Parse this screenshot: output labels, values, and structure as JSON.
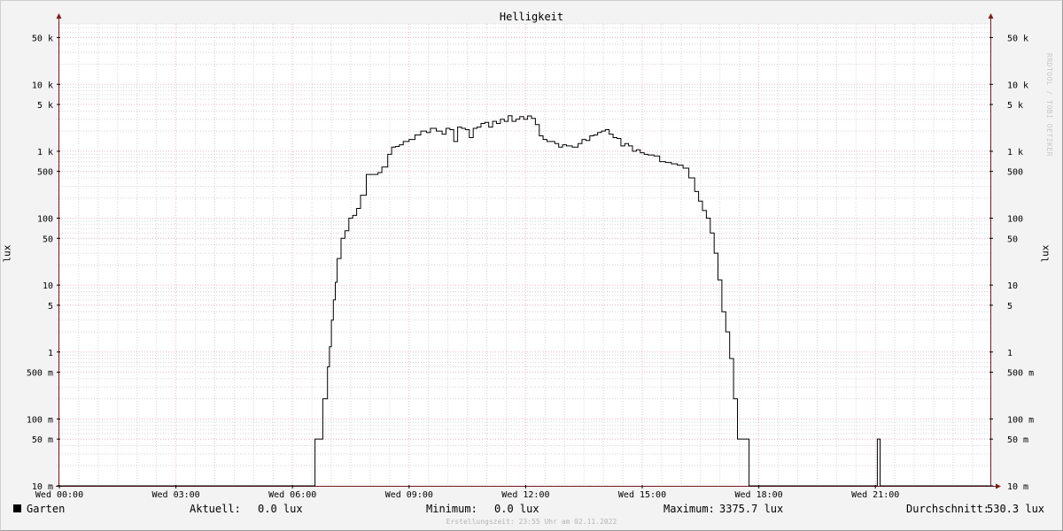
{
  "chart_data": {
    "type": "line",
    "title": "Helligkeit",
    "ylabel": "lux",
    "yscale": "log",
    "ylim": [
      0.01,
      80000
    ],
    "xlim": [
      "00:00",
      "23:55"
    ],
    "x_ticks": [
      {
        "h": 0,
        "label": "Wed 00:00"
      },
      {
        "h": 3,
        "label": "Wed 03:00"
      },
      {
        "h": 6,
        "label": "Wed 06:00"
      },
      {
        "h": 9,
        "label": "Wed 09:00"
      },
      {
        "h": 12,
        "label": "Wed 12:00"
      },
      {
        "h": 15,
        "label": "Wed 15:00"
      },
      {
        "h": 18,
        "label": "Wed 18:00"
      },
      {
        "h": 21,
        "label": "Wed 21:00"
      }
    ],
    "y_ticks": [
      {
        "v": 50000,
        "label": "50 k"
      },
      {
        "v": 10000,
        "label": "10 k"
      },
      {
        "v": 5000,
        "label": "5 k"
      },
      {
        "v": 1000,
        "label": "1 k"
      },
      {
        "v": 500,
        "label": "500"
      },
      {
        "v": 100,
        "label": "100"
      },
      {
        "v": 50,
        "label": "50"
      },
      {
        "v": 10,
        "label": "10"
      },
      {
        "v": 5,
        "label": "5"
      },
      {
        "v": 1,
        "label": "1"
      },
      {
        "v": 0.5,
        "label": "500 m"
      },
      {
        "v": 0.1,
        "label": "100 m"
      },
      {
        "v": 0.05,
        "label": "50 m"
      },
      {
        "v": 0.01,
        "label": "10 m"
      }
    ],
    "grid": true,
    "series": [
      {
        "name": "Garten",
        "color": "#000000",
        "x_hours": [
          0,
          6.58,
          6.62,
          6.78,
          6.9,
          6.95,
          7.0,
          7.05,
          7.1,
          7.15,
          7.25,
          7.35,
          7.45,
          7.55,
          7.65,
          7.75,
          7.9,
          8.05,
          8.2,
          8.3,
          8.45,
          8.55,
          8.65,
          8.75,
          8.85,
          9.0,
          9.15,
          9.3,
          9.45,
          9.55,
          9.7,
          9.85,
          9.95,
          10.05,
          10.15,
          10.25,
          10.35,
          10.45,
          10.55,
          10.65,
          10.75,
          10.85,
          10.95,
          11.05,
          11.15,
          11.25,
          11.35,
          11.45,
          11.55,
          11.65,
          11.75,
          11.85,
          11.95,
          12.05,
          12.15,
          12.25,
          12.35,
          12.45,
          12.55,
          12.65,
          12.75,
          12.85,
          12.95,
          13.05,
          13.2,
          13.35,
          13.45,
          13.55,
          13.65,
          13.75,
          13.85,
          13.95,
          14.05,
          14.15,
          14.25,
          14.35,
          14.45,
          14.55,
          14.65,
          14.75,
          14.85,
          14.95,
          15.05,
          15.15,
          15.3,
          15.45,
          15.6,
          15.75,
          15.9,
          16.05,
          16.2,
          16.35,
          16.45,
          16.55,
          16.65,
          16.75,
          16.85,
          16.95,
          17.05,
          17.15,
          17.25,
          17.35,
          17.45,
          17.55,
          17.65,
          17.75,
          17.85,
          17.95,
          18.05,
          18.15,
          21.05,
          21.12,
          21.4,
          23.92
        ],
        "y_lux": [
          0.01,
          0.05,
          0.05,
          0.2,
          0.6,
          1.2,
          3,
          6,
          11,
          25,
          50,
          65,
          100,
          110,
          140,
          220,
          450,
          450,
          480,
          580,
          900,
          1150,
          1180,
          1250,
          1400,
          1500,
          1750,
          2000,
          1900,
          2200,
          2000,
          1800,
          2200,
          2100,
          1400,
          2300,
          2200,
          2100,
          1600,
          2200,
          2300,
          2600,
          2700,
          2300,
          2800,
          2600,
          3000,
          2800,
          3400,
          2800,
          3000,
          3300,
          3000,
          3375.7,
          3100,
          2500,
          1700,
          1500,
          1400,
          1400,
          1300,
          1150,
          1250,
          1200,
          1150,
          1300,
          1500,
          1450,
          1700,
          1750,
          1900,
          2000,
          2100,
          1800,
          1600,
          1550,
          1200,
          1300,
          1200,
          1000,
          1050,
          950,
          900,
          880,
          850,
          700,
          680,
          650,
          620,
          560,
          400,
          250,
          180,
          130,
          100,
          60,
          30,
          12,
          4,
          2,
          0.8,
          0.2,
          0.05,
          0.05,
          0.05,
          0.01,
          0.01,
          0.01,
          0.01,
          0.01,
          0.05,
          0.01,
          0.01,
          0.0
        ]
      }
    ],
    "legend": {
      "series_name": "Garten",
      "aktuell_label": "Aktuell:",
      "aktuell_value": "0.0 lux",
      "minimum_label": "Minimum:",
      "minimum_value": "0.0 lux",
      "maximum_label": "Maximum:",
      "maximum_value": "3375.7 lux",
      "durchschnitt_label": "Durchschnitt:",
      "durchschnitt_value": "530.3 lux"
    },
    "footer": "Erstellungszeit: 23:55 Uhr am 02.11.2022",
    "watermark": "RRDTOOL / TOBI OETIKER",
    "colors": {
      "major_grid": "#e8b6c4",
      "minor_grid": "#d4d4d4",
      "axis": "#7a1e1e",
      "canvas": "#ffffff",
      "background": "#f3f3f3"
    }
  }
}
